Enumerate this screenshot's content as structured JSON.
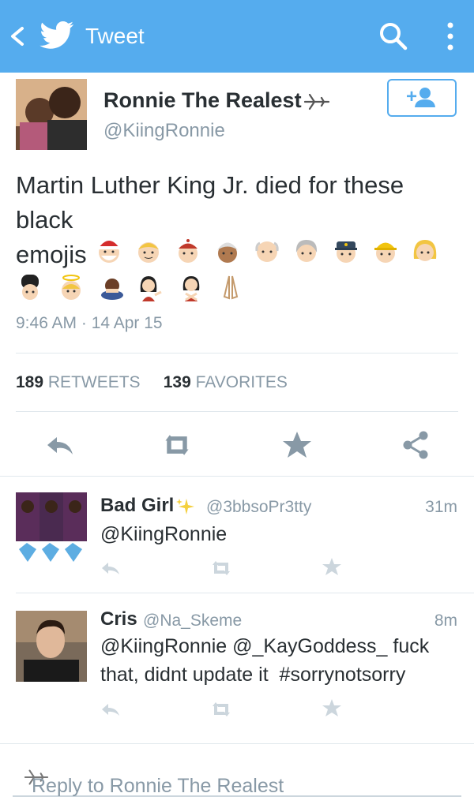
{
  "header": {
    "title": "Tweet",
    "bg_color": "#55acee",
    "icons": [
      "back-icon",
      "twitter-bird-icon",
      "search-icon",
      "more-vertical-icon"
    ]
  },
  "tweet": {
    "name": "Ronnie The Realest",
    "name_suffix_icon": "airplane-icon",
    "handle": "@KiingRonnie",
    "text_line1": "Martin Luther King Jr. died for these",
    "text_line2": "black",
    "text_line3": "emojis",
    "emojis": [
      "santa",
      "blond-boy",
      "chinese-man",
      "indian-man",
      "old-man",
      "old-woman",
      "police-officer",
      "construction-worker",
      "blond-woman",
      "guard",
      "angel",
      "bowing-person",
      "info-desk-person",
      "no-gesture-person",
      "praying-hands"
    ],
    "timestamp": "9:46 AM · 14 Apr 15",
    "retweets_count": "189",
    "retweets_label": "RETWEETS",
    "favorites_count": "139",
    "favorites_label": "FAVORITES"
  },
  "replies": [
    {
      "name": "Bad Girl",
      "name_suffix_icon": "sparkles-icon",
      "handle": "@3bbsoPr3tty",
      "time": "31m",
      "text": "@KiingRonnie"
    },
    {
      "name": "Cris",
      "handle": "@Na_Skeme",
      "time": "8m",
      "text_line1": "@KiingRonnie @_KayGoddess_ fuck",
      "text_line2": "that, didnt update it  #sorrynotsorry"
    }
  ],
  "reply_box": {
    "placeholder": "Reply to Ronnie The Realest"
  },
  "colors": {
    "accent": "#55acee",
    "icon_gray": "#8899a6",
    "text": "#292f33"
  }
}
